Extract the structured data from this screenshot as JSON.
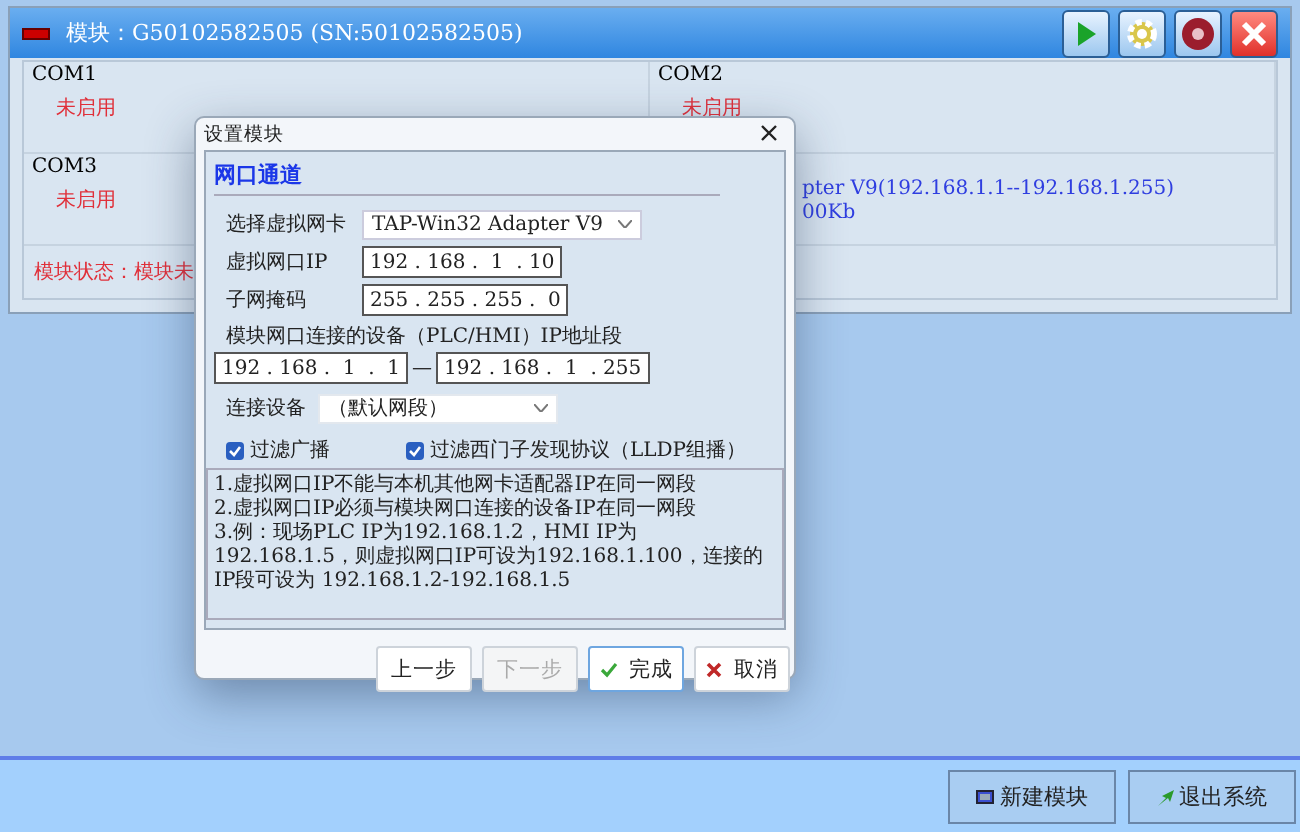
{
  "module": {
    "title": "模块：G50102582505 (SN:50102582505)",
    "ports": [
      {
        "name": "COM1",
        "kind": "idle",
        "lines": [
          "未启用"
        ]
      },
      {
        "name": "COM2",
        "kind": "idle",
        "lines": [
          "未启用"
        ]
      },
      {
        "name": "COM3",
        "kind": "idle",
        "lines": [
          "未启用"
        ]
      },
      {
        "kind": "active",
        "lines": [
          "pter V9(192.168.1.1--192.168.1.255)",
          "00Kb"
        ]
      }
    ],
    "status": "模块状态：模块未"
  },
  "dialog": {
    "title": "设置模块",
    "section": "网口通道",
    "adapter": {
      "label": "选择虚拟网卡",
      "value": "TAP-Win32 Adapter V9"
    },
    "ip": {
      "label": "虚拟网口IP",
      "value": "192 . 168 .  1  . 10"
    },
    "mask": {
      "label": "子网掩码",
      "value": "255 . 255 . 255 .  0"
    },
    "range_label": "模块网口连接的设备（PLC/HMI）IP地址段",
    "range_start": "192 . 168 .  1  .  1",
    "range_separator": "—",
    "range_end": "192 . 168 .  1  . 255",
    "device": {
      "label": "连接设备",
      "value": "（默认网段）"
    },
    "checks": [
      {
        "label": "过滤广播",
        "checked": true
      },
      {
        "label": "过滤西门子发现协议（LLDP组播）",
        "checked": true
      }
    ],
    "notes": [
      "1.虚拟网口IP不能与本机其他网卡适配器IP在同一网段",
      "2.虚拟网口IP必须与模块网口连接的设备IP在同一网段",
      "3.例：现场PLC IP为192.168.1.2，HMI IP为192.168.1.5，则虚拟网口IP可设为192.168.1.100，连接的IP段可设为 192.168.1.2-192.168.1.5"
    ],
    "buttons": [
      {
        "label": "上一步",
        "kind": "plain",
        "disabled": false,
        "focused": false
      },
      {
        "label": "下一步",
        "kind": "plain",
        "disabled": true,
        "focused": false
      },
      {
        "label": "完成",
        "kind": "ok",
        "disabled": false,
        "focused": true
      },
      {
        "label": "取消",
        "kind": "cancel",
        "disabled": false,
        "focused": false
      }
    ]
  },
  "footer": {
    "buttons": [
      {
        "label": "新建模块",
        "kind": "new"
      },
      {
        "label": "退出系统",
        "kind": "exit"
      }
    ]
  }
}
